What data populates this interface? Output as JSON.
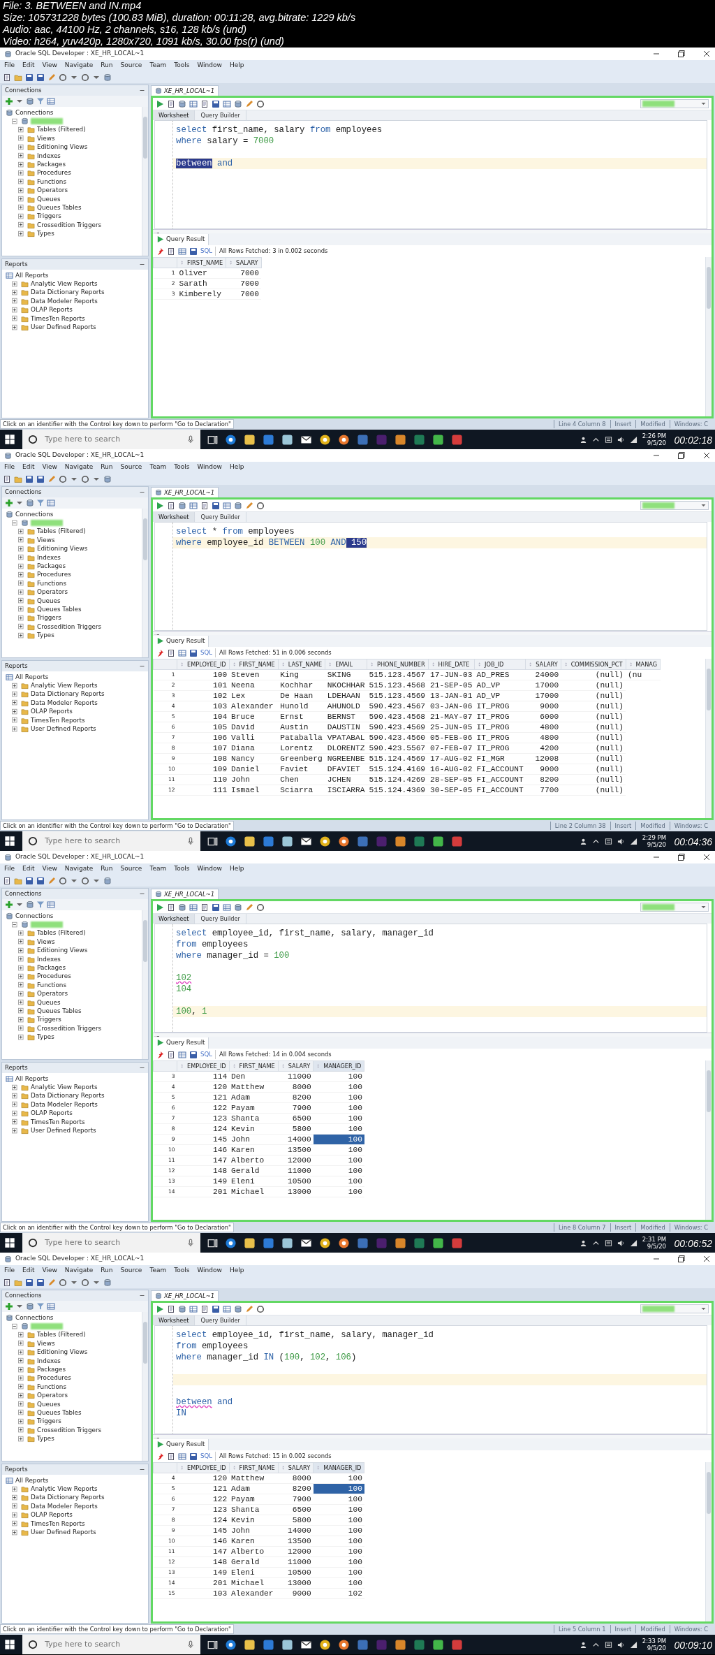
{
  "header": {
    "lines": [
      "File: 3. BETWEEN and IN.mp4",
      "Size: 105731228 bytes (100.83 MiB), duration: 00:11:28, avg.bitrate: 1229 kb/s",
      "Audio: aac, 44100 Hz, 2 channels, s16, 128 kb/s (und)",
      "Video: h264, yuv420p, 1280x720, 1091 kb/s, 30.00 fps(r) (und)"
    ]
  },
  "frames": [
    {
      "window_title": "Oracle SQL Developer : XE_HR_LOCAL~1",
      "menu": [
        "File",
        "Edit",
        "View",
        "Navigate",
        "Run",
        "Source",
        "Team",
        "Tools",
        "Window",
        "Help"
      ],
      "connections": {
        "title": "Connections",
        "tree": [
          {
            "label": "Connections",
            "children": [
              {
                "kind": "connection",
                "expanded": true,
                "children": [
                  {
                    "label": "Tables (Filtered)",
                    "expanded": false
                  },
                  {
                    "label": "Views",
                    "expanded": false
                  },
                  {
                    "label": "Editioning Views",
                    "expanded": false
                  },
                  {
                    "label": "Indexes",
                    "expanded": false
                  },
                  {
                    "label": "Packages",
                    "expanded": false
                  },
                  {
                    "label": "Procedures",
                    "expanded": false
                  },
                  {
                    "label": "Functions",
                    "expanded": false
                  },
                  {
                    "label": "Operators",
                    "expanded": false
                  },
                  {
                    "label": "Queues",
                    "expanded": false
                  },
                  {
                    "label": "Queues Tables",
                    "expanded": false
                  },
                  {
                    "label": "Triggers",
                    "expanded": false
                  },
                  {
                    "label": "Crossedition Triggers",
                    "expanded": false
                  },
                  {
                    "label": "Types",
                    "expanded": false
                  }
                ]
              }
            ]
          }
        ]
      },
      "reports": {
        "title": "Reports",
        "tree": [
          {
            "label": "All Reports",
            "children": [
              {
                "label": "Analytic View Reports",
                "expanded": false
              },
              {
                "label": "Data Dictionary Reports",
                "expanded": false
              },
              {
                "label": "Data Modeler Reports",
                "expanded": false
              },
              {
                "label": "OLAP Reports",
                "expanded": false
              },
              {
                "label": "TimesTen Reports",
                "expanded": false
              },
              {
                "label": "User Defined Reports",
                "expanded": false
              }
            ]
          }
        ]
      },
      "editor": {
        "doc_tab": "XE_HR_LOCAL~1",
        "sheet_tabs": [
          {
            "label": "Worksheet",
            "selected": true
          },
          {
            "label": "Query Builder",
            "selected": false
          }
        ],
        "lines": [
          {
            "current": false,
            "tokens": [
              {
                "t": "select",
                "kind": "keyword"
              },
              {
                "t": " first_name, salary ",
                "kind": "plain"
              },
              {
                "t": "from",
                "kind": "keyword"
              },
              {
                "t": " employees",
                "kind": "plain"
              }
            ]
          },
          {
            "current": false,
            "tokens": [
              {
                "t": "where",
                "kind": "keyword"
              },
              {
                "t": " salary = ",
                "kind": "plain"
              },
              {
                "t": "7000",
                "kind": "number"
              }
            ]
          },
          {
            "current": false
          },
          {
            "current": true,
            "tokens": [
              {
                "t": "between",
                "kind": "selected"
              },
              {
                "t": " and",
                "kind": "keyword"
              }
            ]
          }
        ]
      },
      "result": {
        "tab": "Query Result",
        "sql_label": "SQL",
        "fetch_status": "All Rows Fetched: 3 in 0.002 seconds",
        "columns": [
          {
            "label": "FIRST_NAME",
            "kind": "text",
            "selected": false
          },
          {
            "label": "SALARY",
            "kind": "number",
            "selected": false
          }
        ],
        "rows": [
          {
            "n": "1",
            "selected": false,
            "cells": [
              "Oliver",
              "7000"
            ]
          },
          {
            "n": "2",
            "selected": false,
            "cells": [
              "Sarath",
              "7000"
            ]
          },
          {
            "n": "3",
            "selected": false,
            "cells": [
              "Kimberely",
              "7000"
            ]
          }
        ]
      },
      "status_bar": {
        "hint": "Click on an identifier with the Control key down to perform \"Go to Declaration\"",
        "position": "Line 4 Column 8",
        "mode": "Insert",
        "modified": "Modified",
        "windows": "Windows: C"
      },
      "taskbar": {
        "search_placeholder": "Type here to search",
        "time": "2:26 PM",
        "date": "9/5/20"
      },
      "timestamp": "00:02:18"
    },
    {
      "window_title": "Oracle SQL Developer : XE_HR_LOCAL~1",
      "menu": [
        "File",
        "Edit",
        "View",
        "Navigate",
        "Run",
        "Source",
        "Team",
        "Tools",
        "Window",
        "Help"
      ],
      "connections": {
        "title": "Connections",
        "tree": [
          {
            "label": "Connections",
            "children": [
              {
                "kind": "connection",
                "expanded": true,
                "children": [
                  {
                    "label": "Tables (Filtered)",
                    "expanded": false
                  },
                  {
                    "label": "Views",
                    "expanded": false
                  },
                  {
                    "label": "Editioning Views",
                    "expanded": false
                  },
                  {
                    "label": "Indexes",
                    "expanded": false
                  },
                  {
                    "label": "Packages",
                    "expanded": false
                  },
                  {
                    "label": "Procedures",
                    "expanded": false
                  },
                  {
                    "label": "Functions",
                    "expanded": false
                  },
                  {
                    "label": "Operators",
                    "expanded": false
                  },
                  {
                    "label": "Queues",
                    "expanded": false
                  },
                  {
                    "label": "Queues Tables",
                    "expanded": false
                  },
                  {
                    "label": "Triggers",
                    "expanded": false
                  },
                  {
                    "label": "Crossedition Triggers",
                    "expanded": false
                  },
                  {
                    "label": "Types",
                    "expanded": false
                  }
                ]
              }
            ]
          }
        ]
      },
      "reports": {
        "title": "Reports",
        "tree": [
          {
            "label": "All Reports",
            "children": [
              {
                "label": "Analytic View Reports",
                "expanded": false
              },
              {
                "label": "Data Dictionary Reports",
                "expanded": false
              },
              {
                "label": "Data Modeler Reports",
                "expanded": false
              },
              {
                "label": "OLAP Reports",
                "expanded": false
              },
              {
                "label": "TimesTen Reports",
                "expanded": false
              },
              {
                "label": "User Defined Reports",
                "expanded": false
              }
            ]
          }
        ]
      },
      "editor": {
        "doc_tab": "XE_HR_LOCAL~1",
        "sheet_tabs": [
          {
            "label": "Worksheet",
            "selected": true
          },
          {
            "label": "Query Builder",
            "selected": false
          }
        ],
        "lines": [
          {
            "current": false,
            "tokens": [
              {
                "t": "select",
                "kind": "keyword"
              },
              {
                "t": " * ",
                "kind": "plain"
              },
              {
                "t": "from",
                "kind": "keyword"
              },
              {
                "t": " employees",
                "kind": "plain"
              }
            ]
          },
          {
            "current": true,
            "tokens": [
              {
                "t": "where",
                "kind": "keyword"
              },
              {
                "t": " employee_id ",
                "kind": "plain"
              },
              {
                "t": "BETWEEN",
                "kind": "keyword"
              },
              {
                "t": " 100",
                "kind": "number"
              },
              {
                "t": " AND",
                "kind": "keyword"
              },
              {
                "t": " 150",
                "kind": "selected"
              }
            ]
          }
        ]
      },
      "result": {
        "tab": "Query Result",
        "sql_label": "SQL",
        "fetch_status": "All Rows Fetched: 51 in 0.006 seconds",
        "columns": [
          {
            "label": "EMPLOYEE_ID",
            "kind": "number",
            "selected": false
          },
          {
            "label": "FIRST_NAME",
            "kind": "text",
            "selected": false
          },
          {
            "label": "LAST_NAME",
            "kind": "text",
            "selected": false
          },
          {
            "label": "EMAIL",
            "kind": "text",
            "selected": false
          },
          {
            "label": "PHONE_NUMBER",
            "kind": "text",
            "selected": false
          },
          {
            "label": "HIRE_DATE",
            "kind": "text",
            "selected": false
          },
          {
            "label": "JOB_ID",
            "kind": "text",
            "selected": false
          },
          {
            "label": "SALARY",
            "kind": "number",
            "selected": false
          },
          {
            "label": "COMMISSION_PCT",
            "kind": "number",
            "selected": false
          },
          {
            "label": "MANAG",
            "kind": "text",
            "selected": false
          }
        ],
        "rows": [
          {
            "n": "1",
            "selected": false,
            "cells": [
              "100",
              "Steven",
              "King",
              "SKING",
              "515.123.4567",
              "17-JUN-03",
              "AD_PRES",
              "24000",
              "(null)",
              "(nu"
            ]
          },
          {
            "n": "2",
            "selected": false,
            "cells": [
              "101",
              "Neena",
              "Kochhar",
              "NKOCHHAR",
              "515.123.4568",
              "21-SEP-05",
              "AD_VP",
              "17000",
              "(null)"
            ]
          },
          {
            "n": "3",
            "selected": false,
            "cells": [
              "102",
              "Lex",
              "De Haan",
              "LDEHAAN",
              "515.123.4569",
              "13-JAN-01",
              "AD_VP",
              "17000",
              "(null)"
            ]
          },
          {
            "n": "4",
            "selected": false,
            "cells": [
              "103",
              "Alexander",
              "Hunold",
              "AHUNOLD",
              "590.423.4567",
              "03-JAN-06",
              "IT_PROG",
              "9000",
              "(null)"
            ]
          },
          {
            "n": "5",
            "selected": false,
            "cells": [
              "104",
              "Bruce",
              "Ernst",
              "BERNST",
              "590.423.4568",
              "21-MAY-07",
              "IT_PROG",
              "6000",
              "(null)"
            ]
          },
          {
            "n": "6",
            "selected": false,
            "cells": [
              "105",
              "David",
              "Austin",
              "DAUSTIN",
              "590.423.4569",
              "25-JUN-05",
              "IT_PROG",
              "4800",
              "(null)"
            ]
          },
          {
            "n": "7",
            "selected": false,
            "cells": [
              "106",
              "Valli",
              "Pataballa",
              "VPATABAL",
              "590.423.4560",
              "05-FEB-06",
              "IT_PROG",
              "4800",
              "(null)"
            ]
          },
          {
            "n": "8",
            "selected": false,
            "cells": [
              "107",
              "Diana",
              "Lorentz",
              "DLORENTZ",
              "590.423.5567",
              "07-FEB-07",
              "IT_PROG",
              "4200",
              "(null)"
            ]
          },
          {
            "n": "9",
            "selected": false,
            "cells": [
              "108",
              "Nancy",
              "Greenberg",
              "NGREENBE",
              "515.124.4569",
              "17-AUG-02",
              "FI_MGR",
              "12008",
              "(null)"
            ]
          },
          {
            "n": "10",
            "selected": false,
            "cells": [
              "109",
              "Daniel",
              "Faviet",
              "DFAVIET",
              "515.124.4169",
              "16-AUG-02",
              "FI_ACCOUNT",
              "9000",
              "(null)"
            ]
          },
          {
            "n": "11",
            "selected": false,
            "cells": [
              "110",
              "John",
              "Chen",
              "JCHEN",
              "515.124.4269",
              "28-SEP-05",
              "FI_ACCOUNT",
              "8200",
              "(null)"
            ]
          },
          {
            "n": "12",
            "selected": false,
            "cells": [
              "111",
              "Ismael",
              "Sciarra",
              "ISCIARRA",
              "515.124.4369",
              "30-SEP-05",
              "FI_ACCOUNT",
              "7700",
              "(null)"
            ]
          }
        ]
      },
      "status_bar": {
        "hint": "Click on an identifier with the Control key down to perform \"Go to Declaration\"",
        "position": "Line 2 Column 38",
        "mode": "Insert",
        "modified": "Modified",
        "windows": "Windows: C"
      },
      "taskbar": {
        "search_placeholder": "Type here to search",
        "time": "2:29 PM",
        "date": "9/5/20"
      },
      "timestamp": "00:04:36"
    },
    {
      "window_title": "Oracle SQL Developer : XE_HR_LOCAL~1",
      "menu": [
        "File",
        "Edit",
        "View",
        "Navigate",
        "Run",
        "Source",
        "Team",
        "Tools",
        "Window",
        "Help"
      ],
      "connections": {
        "title": "Connections",
        "tree": [
          {
            "label": "Connections",
            "children": [
              {
                "kind": "connection",
                "expanded": true,
                "children": [
                  {
                    "label": "Tables (Filtered)",
                    "expanded": false
                  },
                  {
                    "label": "Views",
                    "expanded": false
                  },
                  {
                    "label": "Editioning Views",
                    "expanded": false
                  },
                  {
                    "label": "Indexes",
                    "expanded": false
                  },
                  {
                    "label": "Packages",
                    "expanded": false
                  },
                  {
                    "label": "Procedures",
                    "expanded": false
                  },
                  {
                    "label": "Functions",
                    "expanded": false
                  },
                  {
                    "label": "Operators",
                    "expanded": false
                  },
                  {
                    "label": "Queues",
                    "expanded": false
                  },
                  {
                    "label": "Queues Tables",
                    "expanded": false
                  },
                  {
                    "label": "Triggers",
                    "expanded": false
                  },
                  {
                    "label": "Crossedition Triggers",
                    "expanded": false
                  },
                  {
                    "label": "Types",
                    "expanded": false
                  }
                ]
              }
            ]
          }
        ]
      },
      "reports": {
        "title": "Reports",
        "tree": [
          {
            "label": "All Reports",
            "children": [
              {
                "label": "Analytic View Reports",
                "expanded": false
              },
              {
                "label": "Data Dictionary Reports",
                "expanded": false
              },
              {
                "label": "Data Modeler Reports",
                "expanded": false
              },
              {
                "label": "OLAP Reports",
                "expanded": false
              },
              {
                "label": "TimesTen Reports",
                "expanded": false
              },
              {
                "label": "User Defined Reports",
                "expanded": false
              }
            ]
          }
        ]
      },
      "editor": {
        "doc_tab": "XE_HR_LOCAL~1",
        "sheet_tabs": [
          {
            "label": "Worksheet",
            "selected": true
          },
          {
            "label": "Query Builder",
            "selected": false
          }
        ],
        "lines": [
          {
            "current": false,
            "tokens": [
              {
                "t": "select",
                "kind": "keyword"
              },
              {
                "t": " employee_id, first_name, salary, manager_id",
                "kind": "plain"
              }
            ]
          },
          {
            "current": false,
            "tokens": [
              {
                "t": "from",
                "kind": "keyword"
              },
              {
                "t": " employees",
                "kind": "plain"
              }
            ]
          },
          {
            "current": false,
            "tokens": [
              {
                "t": "where",
                "kind": "keyword"
              },
              {
                "t": " manager_id = ",
                "kind": "plain"
              },
              {
                "t": "100",
                "kind": "number"
              }
            ]
          },
          {
            "current": false
          },
          {
            "current": false,
            "tokens": [
              {
                "t": "102",
                "kind": "number-flagged"
              }
            ]
          },
          {
            "current": false,
            "tokens": [
              {
                "t": "104",
                "kind": "number"
              }
            ]
          },
          {
            "current": false
          },
          {
            "current": true,
            "tokens": [
              {
                "t": "100",
                "kind": "number"
              },
              {
                "t": ", ",
                "kind": "plain"
              },
              {
                "t": "1",
                "kind": "number"
              }
            ]
          }
        ]
      },
      "result": {
        "tab": "Query Result",
        "sql_label": "SQL",
        "fetch_status": "All Rows Fetched: 14 in 0.004 seconds",
        "columns": [
          {
            "label": "EMPLOYEE_ID",
            "kind": "number",
            "selected": false
          },
          {
            "label": "FIRST_NAME",
            "kind": "text",
            "selected": false
          },
          {
            "label": "SALARY",
            "kind": "number",
            "selected": false
          },
          {
            "label": "MANAGER_ID",
            "kind": "number",
            "selected": true
          }
        ],
        "rows": [
          {
            "n": "3",
            "selected": false,
            "cells": [
              "114",
              "Den",
              "11000",
              "100"
            ]
          },
          {
            "n": "4",
            "selected": false,
            "cells": [
              "120",
              "Matthew",
              "8000",
              "100"
            ]
          },
          {
            "n": "5",
            "selected": false,
            "cells": [
              "121",
              "Adam",
              "8200",
              "100"
            ]
          },
          {
            "n": "6",
            "selected": false,
            "cells": [
              "122",
              "Payam",
              "7900",
              "100"
            ]
          },
          {
            "n": "7",
            "selected": false,
            "cells": [
              "123",
              "Shanta",
              "6500",
              "100"
            ]
          },
          {
            "n": "8",
            "selected": false,
            "cells": [
              "124",
              "Kevin",
              "5800",
              "100"
            ]
          },
          {
            "n": "9",
            "selected": true,
            "cells": [
              "145",
              "John",
              "14000",
              "100"
            ]
          },
          {
            "n": "10",
            "selected": false,
            "cells": [
              "146",
              "Karen",
              "13500",
              "100"
            ]
          },
          {
            "n": "11",
            "selected": false,
            "cells": [
              "147",
              "Alberto",
              "12000",
              "100"
            ]
          },
          {
            "n": "12",
            "selected": false,
            "cells": [
              "148",
              "Gerald",
              "11000",
              "100"
            ]
          },
          {
            "n": "13",
            "selected": false,
            "cells": [
              "149",
              "Eleni",
              "10500",
              "100"
            ]
          },
          {
            "n": "14",
            "selected": false,
            "cells": [
              "201",
              "Michael",
              "13000",
              "100"
            ]
          }
        ]
      },
      "status_bar": {
        "hint": "Click on an identifier with the Control key down to perform \"Go to Declaration\"",
        "position": "Line 8 Column 7",
        "mode": "Insert",
        "modified": "Modified",
        "windows": "Windows: C"
      },
      "taskbar": {
        "search_placeholder": "Type here to search",
        "time": "2:31 PM",
        "date": "9/5/20"
      },
      "timestamp": "00:06:52"
    },
    {
      "window_title": "Oracle SQL Developer : XE_HR_LOCAL~1",
      "menu": [
        "File",
        "Edit",
        "View",
        "Navigate",
        "Run",
        "Source",
        "Team",
        "Tools",
        "Window",
        "Help"
      ],
      "connections": {
        "title": "Connections",
        "tree": [
          {
            "label": "Connections",
            "children": [
              {
                "kind": "connection",
                "expanded": true,
                "children": [
                  {
                    "label": "Tables (Filtered)",
                    "expanded": false
                  },
                  {
                    "label": "Views",
                    "expanded": false
                  },
                  {
                    "label": "Editioning Views",
                    "expanded": false
                  },
                  {
                    "label": "Indexes",
                    "expanded": false
                  },
                  {
                    "label": "Packages",
                    "expanded": false
                  },
                  {
                    "label": "Procedures",
                    "expanded": false
                  },
                  {
                    "label": "Functions",
                    "expanded": false
                  },
                  {
                    "label": "Operators",
                    "expanded": false
                  },
                  {
                    "label": "Queues",
                    "expanded": false
                  },
                  {
                    "label": "Queues Tables",
                    "expanded": false
                  },
                  {
                    "label": "Triggers",
                    "expanded": false
                  },
                  {
                    "label": "Crossedition Triggers",
                    "expanded": false
                  },
                  {
                    "label": "Types",
                    "expanded": false
                  }
                ]
              }
            ]
          }
        ]
      },
      "reports": {
        "title": "Reports",
        "tree": [
          {
            "label": "All Reports",
            "children": [
              {
                "label": "Analytic View Reports",
                "expanded": false
              },
              {
                "label": "Data Dictionary Reports",
                "expanded": false
              },
              {
                "label": "Data Modeler Reports",
                "expanded": false
              },
              {
                "label": "OLAP Reports",
                "expanded": false
              },
              {
                "label": "TimesTen Reports",
                "expanded": false
              },
              {
                "label": "User Defined Reports",
                "expanded": false
              }
            ]
          }
        ]
      },
      "editor": {
        "doc_tab": "XE_HR_LOCAL~1",
        "sheet_tabs": [
          {
            "label": "Worksheet",
            "selected": true
          },
          {
            "label": "Query Builder",
            "selected": false
          }
        ],
        "lines": [
          {
            "current": false,
            "tokens": [
              {
                "t": "select",
                "kind": "keyword"
              },
              {
                "t": " employee_id, first_name, salary, manager_id",
                "kind": "plain"
              }
            ]
          },
          {
            "current": false,
            "tokens": [
              {
                "t": "from",
                "kind": "keyword"
              },
              {
                "t": " employees",
                "kind": "plain"
              }
            ]
          },
          {
            "current": false,
            "tokens": [
              {
                "t": "where",
                "kind": "keyword"
              },
              {
                "t": " manager_id ",
                "kind": "plain"
              },
              {
                "t": "IN",
                "kind": "keyword"
              },
              {
                "t": " (",
                "kind": "plain"
              },
              {
                "t": "100",
                "kind": "number"
              },
              {
                "t": ", ",
                "kind": "plain"
              },
              {
                "t": "102",
                "kind": "number"
              },
              {
                "t": ", ",
                "kind": "plain"
              },
              {
                "t": "106",
                "kind": "number"
              },
              {
                "t": ")",
                "kind": "plain"
              }
            ]
          },
          {
            "current": false
          },
          {
            "current": true
          },
          {
            "current": false
          },
          {
            "current": false,
            "tokens": [
              {
                "t": "between",
                "kind": "keyword-flagged"
              },
              {
                "t": " and",
                "kind": "keyword"
              }
            ]
          },
          {
            "current": false,
            "tokens": [
              {
                "t": "IN",
                "kind": "keyword"
              }
            ]
          }
        ]
      },
      "result": {
        "tab": "Query Result",
        "sql_label": "SQL",
        "fetch_status": "All Rows Fetched: 15 in 0.002 seconds",
        "columns": [
          {
            "label": "EMPLOYEE_ID",
            "kind": "number",
            "selected": false
          },
          {
            "label": "FIRST_NAME",
            "kind": "text",
            "selected": false
          },
          {
            "label": "SALARY",
            "kind": "number",
            "selected": false
          },
          {
            "label": "MANAGER_ID",
            "kind": "number",
            "selected": true
          }
        ],
        "rows": [
          {
            "n": "4",
            "selected": false,
            "cells": [
              "120",
              "Matthew",
              "8000",
              "100"
            ]
          },
          {
            "n": "5",
            "selected": true,
            "cells": [
              "121",
              "Adam",
              "8200",
              "100"
            ]
          },
          {
            "n": "6",
            "selected": false,
            "cells": [
              "122",
              "Payam",
              "7900",
              "100"
            ]
          },
          {
            "n": "7",
            "selected": false,
            "cells": [
              "123",
              "Shanta",
              "6500",
              "100"
            ]
          },
          {
            "n": "8",
            "selected": false,
            "cells": [
              "124",
              "Kevin",
              "5800",
              "100"
            ]
          },
          {
            "n": "9",
            "selected": false,
            "cells": [
              "145",
              "John",
              "14000",
              "100"
            ]
          },
          {
            "n": "10",
            "selected": false,
            "cells": [
              "146",
              "Karen",
              "13500",
              "100"
            ]
          },
          {
            "n": "11",
            "selected": false,
            "cells": [
              "147",
              "Alberto",
              "12000",
              "100"
            ]
          },
          {
            "n": "12",
            "selected": false,
            "cells": [
              "148",
              "Gerald",
              "11000",
              "100"
            ]
          },
          {
            "n": "13",
            "selected": false,
            "cells": [
              "149",
              "Eleni",
              "10500",
              "100"
            ]
          },
          {
            "n": "14",
            "selected": false,
            "cells": [
              "201",
              "Michael",
              "13000",
              "100"
            ]
          },
          {
            "n": "15",
            "selected": false,
            "cells": [
              "103",
              "Alexander",
              "9000",
              "102"
            ]
          }
        ]
      },
      "status_bar": {
        "hint": "Click on an identifier with the Control key down to perform \"Go to Declaration\"",
        "position": "Line 5 Column 1",
        "mode": "Insert",
        "modified": "Modified",
        "windows": "Windows: C"
      },
      "taskbar": {
        "search_placeholder": "Type here to search",
        "time": "2:33 PM",
        "date": "9/5/20"
      },
      "timestamp": "00:09:10"
    }
  ]
}
